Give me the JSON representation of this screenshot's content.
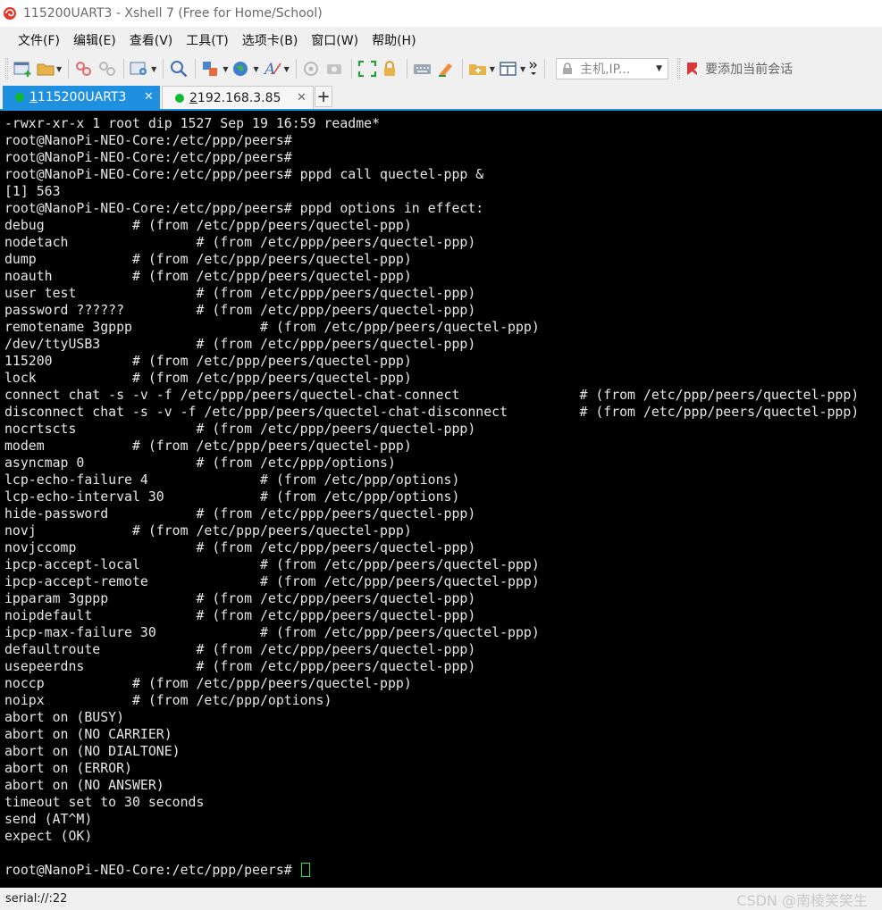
{
  "window": {
    "title": "115200UART3 - Xshell 7 (Free for Home/School)"
  },
  "menu": [
    "文件(F)",
    "编辑(E)",
    "查看(V)",
    "工具(T)",
    "选项卡(B)",
    "窗口(W)",
    "帮助(H)"
  ],
  "toolbar": {
    "host_placeholder": "主机,IP...",
    "add_session_label": "要添加当前会话"
  },
  "tabs": [
    {
      "num": "1",
      "label": " 115200UART3",
      "active": true
    },
    {
      "num": "2",
      "label": " 192.168.3.85",
      "active": false
    }
  ],
  "terminal": {
    "lines": [
      "-rwxr-xr-x 1 root dip 1527 Sep 19 16:59 readme*",
      "root@NanoPi-NEO-Core:/etc/ppp/peers#",
      "root@NanoPi-NEO-Core:/etc/ppp/peers#",
      "root@NanoPi-NEO-Core:/etc/ppp/peers# pppd call quectel-ppp &",
      "[1] 563",
      "root@NanoPi-NEO-Core:/etc/ppp/peers# pppd options in effect:",
      "debug           # (from /etc/ppp/peers/quectel-ppp)",
      "nodetach                # (from /etc/ppp/peers/quectel-ppp)",
      "dump            # (from /etc/ppp/peers/quectel-ppp)",
      "noauth          # (from /etc/ppp/peers/quectel-ppp)",
      "user test               # (from /etc/ppp/peers/quectel-ppp)",
      "password ??????         # (from /etc/ppp/peers/quectel-ppp)",
      "remotename 3gppp                # (from /etc/ppp/peers/quectel-ppp)",
      "/dev/ttyUSB3            # (from /etc/ppp/peers/quectel-ppp)",
      "115200          # (from /etc/ppp/peers/quectel-ppp)",
      "lock            # (from /etc/ppp/peers/quectel-ppp)",
      "connect chat -s -v -f /etc/ppp/peers/quectel-chat-connect               # (from /etc/ppp/peers/quectel-ppp)",
      "disconnect chat -s -v -f /etc/ppp/peers/quectel-chat-disconnect         # (from /etc/ppp/peers/quectel-ppp)",
      "nocrtscts               # (from /etc/ppp/peers/quectel-ppp)",
      "modem           # (from /etc/ppp/peers/quectel-ppp)",
      "asyncmap 0              # (from /etc/ppp/options)",
      "lcp-echo-failure 4              # (from /etc/ppp/options)",
      "lcp-echo-interval 30            # (from /etc/ppp/options)",
      "hide-password           # (from /etc/ppp/peers/quectel-ppp)",
      "novj            # (from /etc/ppp/peers/quectel-ppp)",
      "novjccomp               # (from /etc/ppp/peers/quectel-ppp)",
      "ipcp-accept-local               # (from /etc/ppp/peers/quectel-ppp)",
      "ipcp-accept-remote              # (from /etc/ppp/peers/quectel-ppp)",
      "ipparam 3gppp           # (from /etc/ppp/peers/quectel-ppp)",
      "noipdefault             # (from /etc/ppp/peers/quectel-ppp)",
      "ipcp-max-failure 30             # (from /etc/ppp/peers/quectel-ppp)",
      "defaultroute            # (from /etc/ppp/peers/quectel-ppp)",
      "usepeerdns              # (from /etc/ppp/peers/quectel-ppp)",
      "noccp           # (from /etc/ppp/peers/quectel-ppp)",
      "noipx           # (from /etc/ppp/options)",
      "abort on (BUSY)",
      "abort on (NO CARRIER)",
      "abort on (NO DIALTONE)",
      "abort on (ERROR)",
      "abort on (NO ANSWER)",
      "timeout set to 30 seconds",
      "send (AT^M)",
      "expect (OK)",
      ""
    ],
    "prompt": "root@NanoPi-NEO-Core:/etc/ppp/peers# "
  },
  "status": {
    "connection": "serial://:22"
  },
  "watermark": "CSDN @南棱笑笑生"
}
